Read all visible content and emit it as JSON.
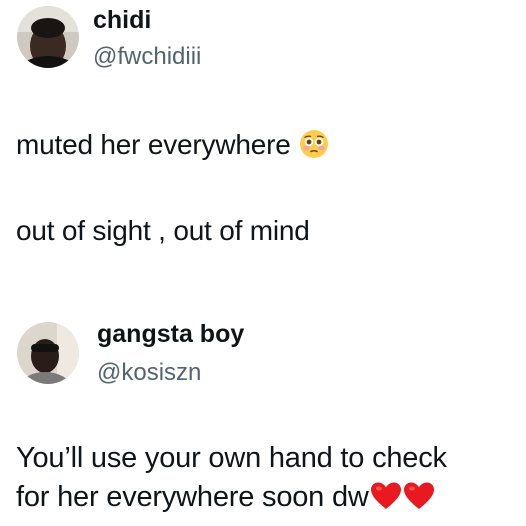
{
  "posts": [
    {
      "author": {
        "display_name": "chidi",
        "handle": "@fwchidiii",
        "avatar": "profile-photo"
      },
      "lines": [
        {
          "text": "muted her everywhere",
          "emoji": "flushed-face-emoji"
        },
        {
          "text": "out of sight , out of mind"
        }
      ]
    },
    {
      "author": {
        "display_name": "gangsta boy",
        "handle": "@kosiszn",
        "avatar": "profile-photo"
      },
      "lines": [
        {
          "text": "You’ll use your own hand to check"
        },
        {
          "text": "for her everywhere soon dw",
          "emoji": "red-heart-emoji",
          "emoji_count": 2
        }
      ]
    }
  ],
  "colors": {
    "text": "#0f1419",
    "handle": "#536471",
    "heart": "#e8191f"
  }
}
